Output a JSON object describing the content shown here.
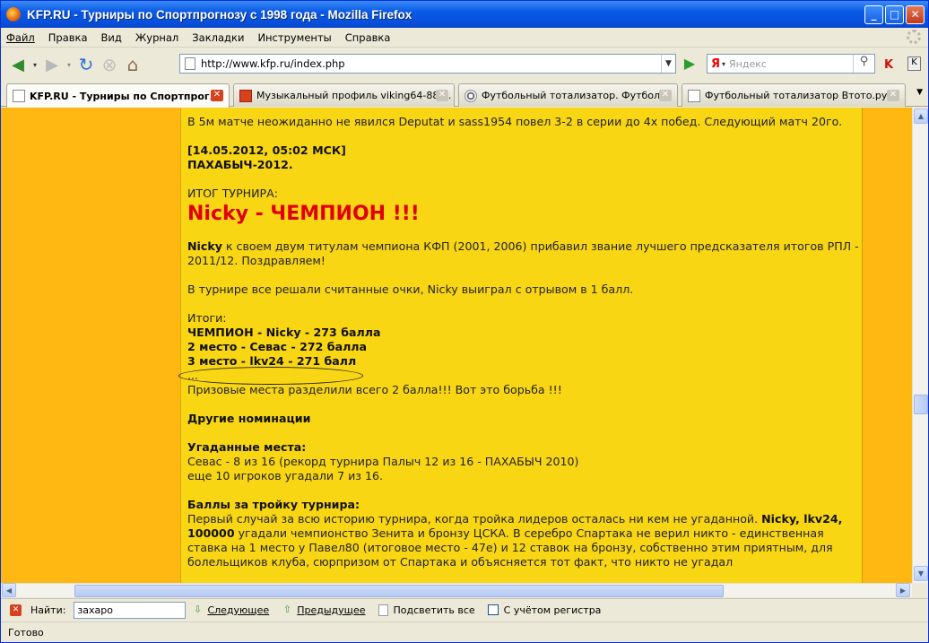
{
  "window": {
    "title": "KFP.RU - Турниры по Спортпрогнозу с 1998 года - Mozilla Firefox"
  },
  "menu": [
    "Файл",
    "Правка",
    "Вид",
    "Журнал",
    "Закладки",
    "Инструменты",
    "Справка"
  ],
  "nav": {
    "url": "http://www.kfp.ru/index.php",
    "search_placeholder": "Яндекс",
    "search_engine": "Я"
  },
  "tabs": [
    {
      "label": "KFP.RU - Турниры по Спортпрог...",
      "active": true
    },
    {
      "label": "Музыкальный профиль viking64-88 ...",
      "active": false
    },
    {
      "label": "Футбольный тотализатор. Футбол ...",
      "active": false
    },
    {
      "label": "Футбольный тотализатор Втото.ру ...",
      "active": false
    }
  ],
  "article": {
    "p1": "В 5м матче неожиданно не явился Deputat и sass1954 повел 3-2 в серии до 4х побед. Следующий матч 20го.",
    "date": "[14.05.2012, 05:02 МСК]",
    "tour": "ПАХАБЫЧ-2012.",
    "result_label": "ИТОГ ТУРНИРА:",
    "champion": "Nicky - ЧЕМПИОН !!!",
    "congrats_name": "Nicky",
    "congrats_text": " к своем двум титулам чемпиона КФП (2001, 2006) прибавил звание лучшего предсказателя итогов РПЛ - 2011/12. Поздравляем!",
    "p_points": "В турнире все решали считанные очки, Nicky выиграл с отрывом в 1 балл.",
    "totals_label": "Итоги:",
    "place1": "ЧЕМПИОН - Nicky - 273 балла",
    "place2": "2 место - Севас - 272 балла",
    "place3": "3 место - lkv24 - 271 балл",
    "ellipsis": "...",
    "prize_text": "Призовые места разделили всего 2 балла!!! Вот это борьба !!!",
    "other_nom": "Другие номинации",
    "guessed_title": "Угаданные места:",
    "guessed_1": "Севас - 8 из 16 (рекорд турнира Палыч 12 из 16 - ПАХАБЫЧ 2010)",
    "guessed_2": "еще 10 игроков угадали 7 из 16.",
    "top3_title": "Баллы за тройку турнира:",
    "top3_a": "Первый случай за всю историю турнира, когда тройка лидеров осталась ни кем не угаданной. ",
    "top3_b": "Nicky, lkv24, 100000",
    "top3_c": " угадали чемпионство Зенита и бронзу ЦСКА. В серебро Спартака не верил никто - единственная ставка на 1 место у Павел80 (итоговое место - 47е) и 12 ставок на бронзу, собственно этим приятным, для болельщиков клуба, сюрпризом от Спартака и объясняется тот факт, что никто не угадал"
  },
  "findbar": {
    "label": "Найти:",
    "value": "захаро",
    "next": "Следующее",
    "prev": "Предыдущее",
    "highlight": "Подсветить все",
    "match_case": "С учётом регистра"
  },
  "status": "Готово"
}
